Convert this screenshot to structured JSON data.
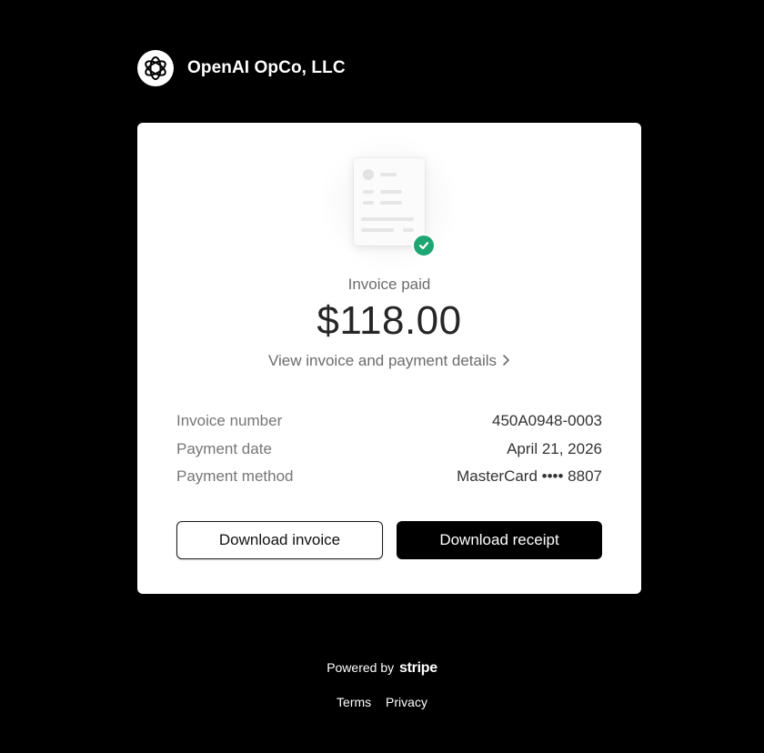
{
  "header": {
    "company_name": "OpenAI OpCo, LLC",
    "logo_icon": "openai-logo-icon"
  },
  "invoice": {
    "status": "Invoice paid",
    "amount": "$118.00",
    "view_details_label": "View invoice and payment details",
    "details": [
      {
        "label": "Invoice number",
        "value": "450A0948-0003"
      },
      {
        "label": "Payment date",
        "value": "April 21, 2026"
      },
      {
        "label": "Payment method",
        "value": "MasterCard •••• 8807"
      }
    ],
    "download_invoice_label": "Download invoice",
    "download_receipt_label": "Download receipt",
    "status_color": "#1ea672"
  },
  "footer": {
    "powered_by": "Powered by",
    "brand": "stripe",
    "links": {
      "terms": "Terms",
      "privacy": "Privacy"
    }
  }
}
